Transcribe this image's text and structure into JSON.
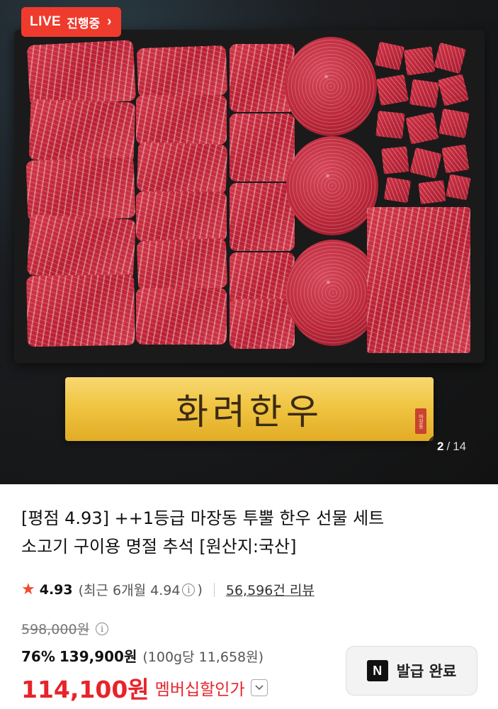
{
  "live_badge": {
    "live": "LIVE",
    "status": "진행중",
    "chevron": "›"
  },
  "banner": {
    "brand": "화려한우",
    "seal": "마장동"
  },
  "pager": {
    "current": "2",
    "total": "14"
  },
  "product": {
    "title_line1": "[평점 4.93] ++1등급 마장동 투뿔 한우 선물 세트",
    "title_line2": "소고기 구이용 명절 추석 [원산지:국산]"
  },
  "rating": {
    "score": "4.93",
    "recent_open": "(최근 6개월 4.94",
    "recent_close": ")",
    "reviews": "56,596건 리뷰",
    "star_color": "#f04a2c"
  },
  "price": {
    "original": "598,000원",
    "discount_rate": "76%",
    "discount_price": "139,900원",
    "unit_price": "(100g당 11,658원)",
    "member_price": "114,100원",
    "member_label": "멤버십할인가",
    "accent_color": "#e8232a"
  },
  "coupon": {
    "icon_letter": "N",
    "label": "발급 완료"
  },
  "icons": {
    "info": "info-icon",
    "star": "star-icon",
    "dropdown": "chevron-down-icon"
  }
}
